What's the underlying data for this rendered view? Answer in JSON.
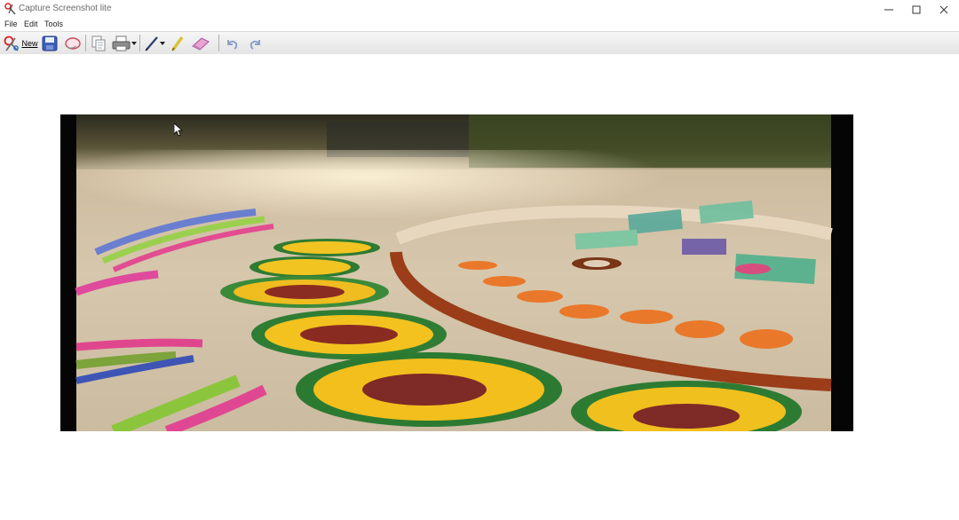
{
  "window": {
    "title": "Capture Screenshot lite",
    "minimize_glyph": "—",
    "maximize_glyph": "☐",
    "close_glyph": "✕"
  },
  "menu": {
    "items": [
      {
        "label": "File"
      },
      {
        "label": "Edit"
      },
      {
        "label": "Tools"
      }
    ]
  },
  "toolbar": {
    "new_label": "New",
    "buttons": [
      {
        "icon": "new-capture-icon"
      },
      {
        "icon": "save-icon"
      },
      {
        "icon": "lasso-icon"
      },
      {
        "icon": "copy-icon"
      },
      {
        "icon": "print-icon"
      },
      {
        "icon": "pen-icon"
      },
      {
        "icon": "highlighter-icon"
      },
      {
        "icon": "eraser-icon"
      },
      {
        "icon": "undo-icon"
      },
      {
        "icon": "redo-icon"
      }
    ]
  },
  "capture": {
    "image": "rangoli-photo"
  },
  "colors": {
    "toolbar_bg": "#ececec",
    "canvas_bg": "#ffffff",
    "title_text": "#6b6b6b"
  }
}
